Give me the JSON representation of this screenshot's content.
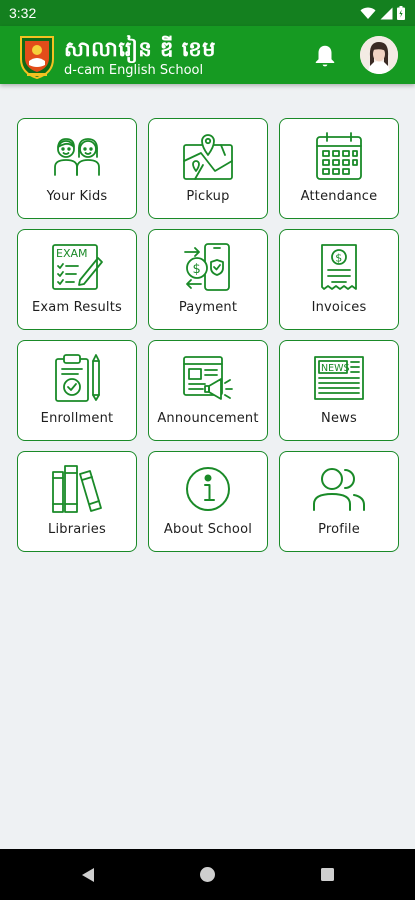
{
  "status_bar": {
    "time": "3:32"
  },
  "app_bar": {
    "title_km": "សាលារៀន ឌី ខេម",
    "title_en": "d-cam English School",
    "brand_color": "#169a22"
  },
  "menu": [
    {
      "label": "Your Kids",
      "icon": "kids-icon"
    },
    {
      "label": "Pickup",
      "icon": "map-pin-icon"
    },
    {
      "label": "Attendance",
      "icon": "calendar-icon"
    },
    {
      "label": "Exam Results",
      "icon": "exam-icon"
    },
    {
      "label": "Payment",
      "icon": "payment-icon"
    },
    {
      "label": "Invoices",
      "icon": "invoice-icon"
    },
    {
      "label": "Enrollment",
      "icon": "clipboard-icon"
    },
    {
      "label": "Announcement",
      "icon": "megaphone-icon"
    },
    {
      "label": "News",
      "icon": "newspaper-icon"
    },
    {
      "label": "Libraries",
      "icon": "books-icon"
    },
    {
      "label": "About School",
      "icon": "info-icon"
    },
    {
      "label": "Profile",
      "icon": "people-icon"
    }
  ],
  "icon_labels": {
    "exam": "EXAM",
    "news": "NEWS"
  },
  "accent_color": "#1a8a28"
}
